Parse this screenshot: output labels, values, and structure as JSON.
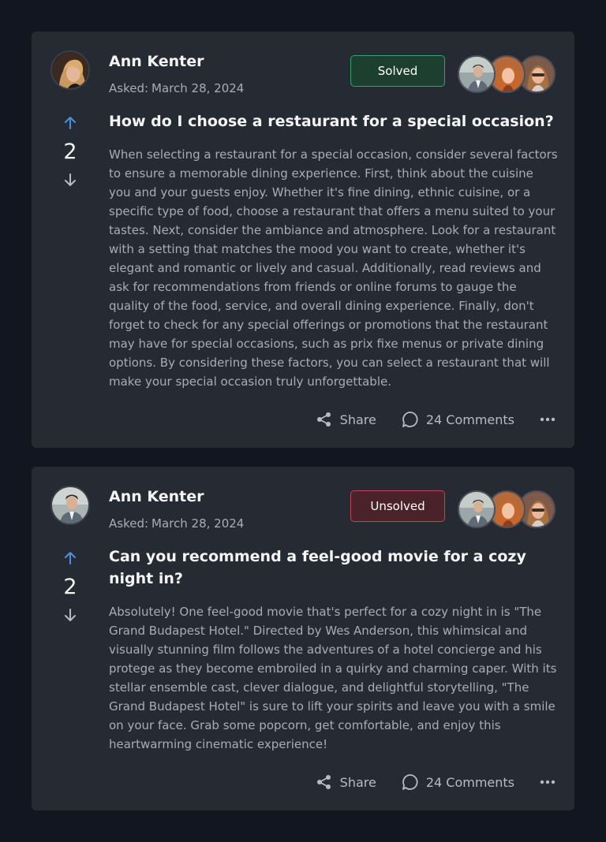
{
  "posts": [
    {
      "author": "Ann Kenter",
      "asked_label": "Asked:",
      "asked_date": "March 28, 2024",
      "status": "Solved",
      "votes": "2",
      "title": "How do I choose a restaurant for a special occasion?",
      "body": "When selecting a restaurant for a special occasion, consider several factors to ensure a memorable dining experience. First, think about the cuisine you and your guests enjoy. Whether it's fine dining, ethnic cuisine, or a specific type of food, choose a restaurant that offers a menu suited to your tastes. Next, consider the ambiance and atmosphere. Look for a restaurant with a setting that matches the mood you want to create, whether it's elegant and romantic or lively and casual. Additionally, read reviews and ask for recommendations from friends or online forums to gauge the quality of the food, service, and overall dining experience. Finally, don't forget to check for any special offerings or promotions that the restaurant may have for special occasions, such as prix fixe menus or private dining options. By considering these factors, you can select a restaurant that will make your special occasion truly unforgettable.",
      "share_label": "Share",
      "comments_label": "24 Comments"
    },
    {
      "author": "Ann Kenter",
      "asked_label": "Asked:",
      "asked_date": "March 28, 2024",
      "status": "Unsolved",
      "votes": "2",
      "title": "Can you recommend a feel-good movie for a cozy night in?",
      "body": "Absolutely! One feel-good movie that's perfect for a cozy night in is \"The Grand Budapest Hotel.\" Directed by Wes Anderson, this whimsical and visually stunning film follows the adventures of a hotel concierge and his protege as they become embroiled in a quirky and charming caper. With its stellar ensemble cast, clever dialogue, and delightful storytelling, \"The Grand Budapest Hotel\" is sure to lift your spirits and leave you with a smile on your face. Grab some popcorn, get comfortable, and enjoy this heartwarming cinematic experience!",
      "share_label": "Share",
      "comments_label": "24 Comments"
    }
  ],
  "colors": {
    "accent_up": "#4a8fe7",
    "solved_border": "#2fa566",
    "unsolved_border": "#c04555",
    "card_bg": "#262b33",
    "page_bg": "#111621"
  },
  "icons": [
    "arrow-up-icon",
    "arrow-down-icon",
    "share-icon",
    "comment-icon",
    "more-icon"
  ]
}
